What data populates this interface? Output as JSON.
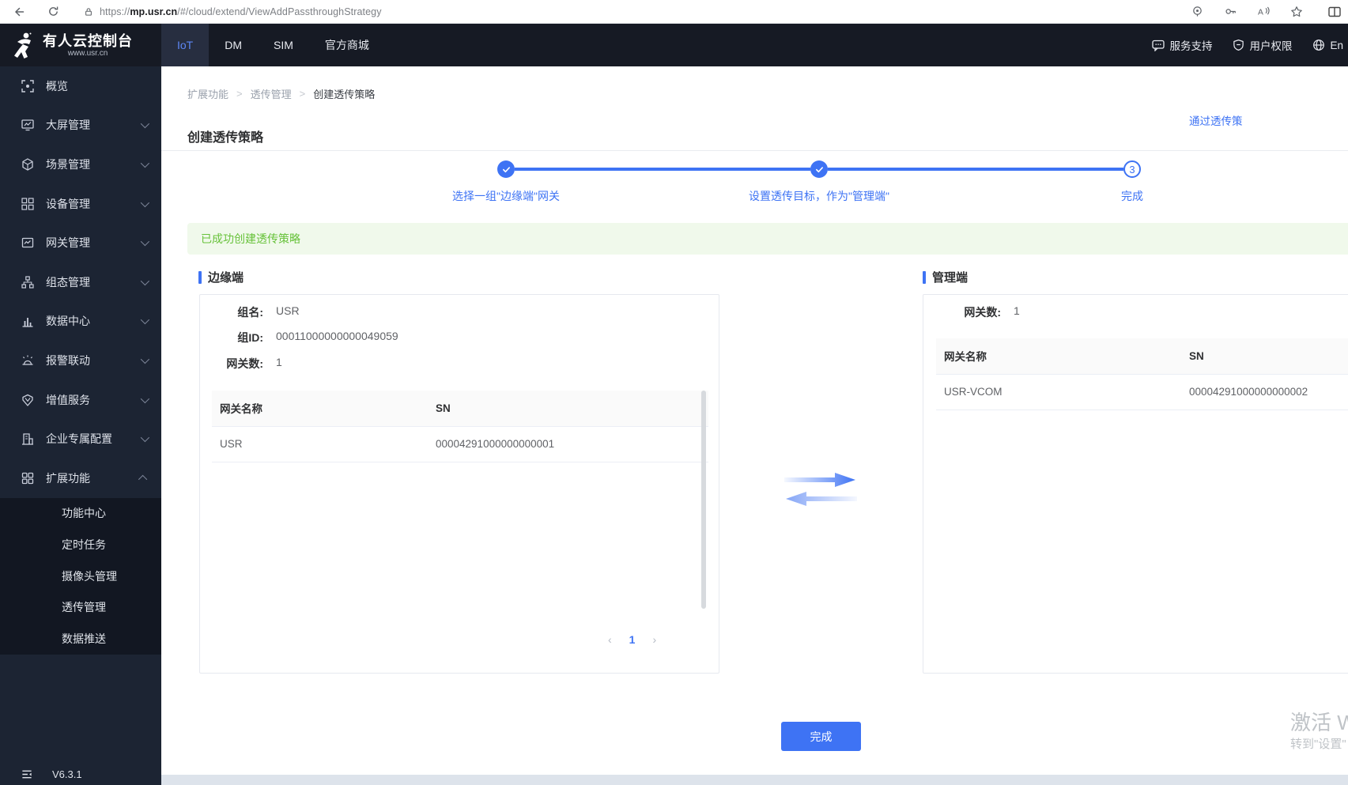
{
  "browser": {
    "url_scheme": "https://",
    "url_host": "mp.usr.cn",
    "url_path": "/#/cloud/extend/ViewAddPassthroughStrategy"
  },
  "navbar": {
    "logo_title": "有人云控制台",
    "logo_subtitle": "www.usr.cn",
    "tabs": [
      {
        "label": "IoT"
      },
      {
        "label": "DM"
      },
      {
        "label": "SIM"
      },
      {
        "label": "官方商城"
      }
    ],
    "right": {
      "support": "服务支持",
      "permission": "用户权限",
      "lang": "En"
    }
  },
  "sidebar": {
    "items": [
      {
        "label": "概览"
      },
      {
        "label": "大屏管理"
      },
      {
        "label": "场景管理"
      },
      {
        "label": "设备管理"
      },
      {
        "label": "网关管理"
      },
      {
        "label": "组态管理"
      },
      {
        "label": "数据中心"
      },
      {
        "label": "报警联动"
      },
      {
        "label": "增值服务"
      },
      {
        "label": "企业专属配置"
      },
      {
        "label": "扩展功能"
      }
    ],
    "submenu": [
      {
        "label": "功能中心"
      },
      {
        "label": "定时任务"
      },
      {
        "label": "摄像头管理"
      },
      {
        "label": "透传管理"
      },
      {
        "label": "数据推送"
      }
    ],
    "version": "V6.3.1"
  },
  "breadcrumb": {
    "items": [
      "扩展功能",
      "透传管理",
      "创建透传策略"
    ],
    "separator": ">"
  },
  "page": {
    "title": "创建透传策略",
    "top_link": "通过透传策",
    "success_message": "已成功创建透传策略"
  },
  "stepper": {
    "steps": [
      {
        "label": "选择一组\"边缘端\"网关"
      },
      {
        "label": "设置透传目标，作为\"管理端\""
      },
      {
        "label": "完成",
        "number": "3"
      }
    ]
  },
  "edge_panel": {
    "title": "边缘端",
    "fields": [
      {
        "label": "组名:",
        "value": "USR"
      },
      {
        "label": "组ID:",
        "value": "00011000000000049059"
      },
      {
        "label": "网关数:",
        "value": "1"
      }
    ],
    "table": {
      "headers": [
        "网关名称",
        "SN"
      ],
      "rows": [
        [
          "USR",
          "00004291000000000001"
        ]
      ]
    },
    "pagination": {
      "prev": "‹",
      "page": "1",
      "next": "›"
    }
  },
  "manage_panel": {
    "title": "管理端",
    "fields": [
      {
        "label": "网关数:",
        "value": "1"
      }
    ],
    "table": {
      "headers": [
        "网关名称",
        "SN"
      ],
      "rows": [
        [
          "USR-VCOM",
          "00004291000000000002"
        ]
      ]
    }
  },
  "footer": {
    "finish_button": "完成"
  },
  "watermark": {
    "line1": "激活 Wi",
    "line2": "转到\"设置\""
  },
  "colors": {
    "accent": "#3e73f4",
    "success_text": "#67c23a",
    "success_bg": "#f0f9eb",
    "navbar_bg": "#161a24",
    "sidebar_bg": "#1c2433"
  }
}
